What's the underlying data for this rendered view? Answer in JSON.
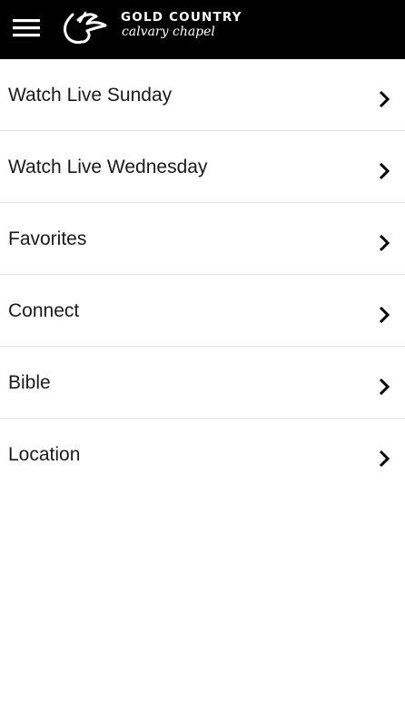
{
  "header": {
    "menu_icon": "hamburger-icon",
    "brand_line1": "GOLD COUNTRY",
    "brand_line2": "calvary chapel",
    "logo_icon": "dove-icon",
    "background_color": "#000000",
    "text_color": "#ffffff"
  },
  "menu": {
    "items": [
      {
        "label": "Watch Live Sunday",
        "icon": "chevron-right-icon"
      },
      {
        "label": "Watch Live Wednesday",
        "icon": "chevron-right-icon"
      },
      {
        "label": "Favorites",
        "icon": "chevron-right-icon"
      },
      {
        "label": "Connect",
        "icon": "chevron-right-icon"
      },
      {
        "label": "Bible",
        "icon": "chevron-right-icon"
      },
      {
        "label": "Location",
        "icon": "chevron-right-icon"
      }
    ]
  }
}
